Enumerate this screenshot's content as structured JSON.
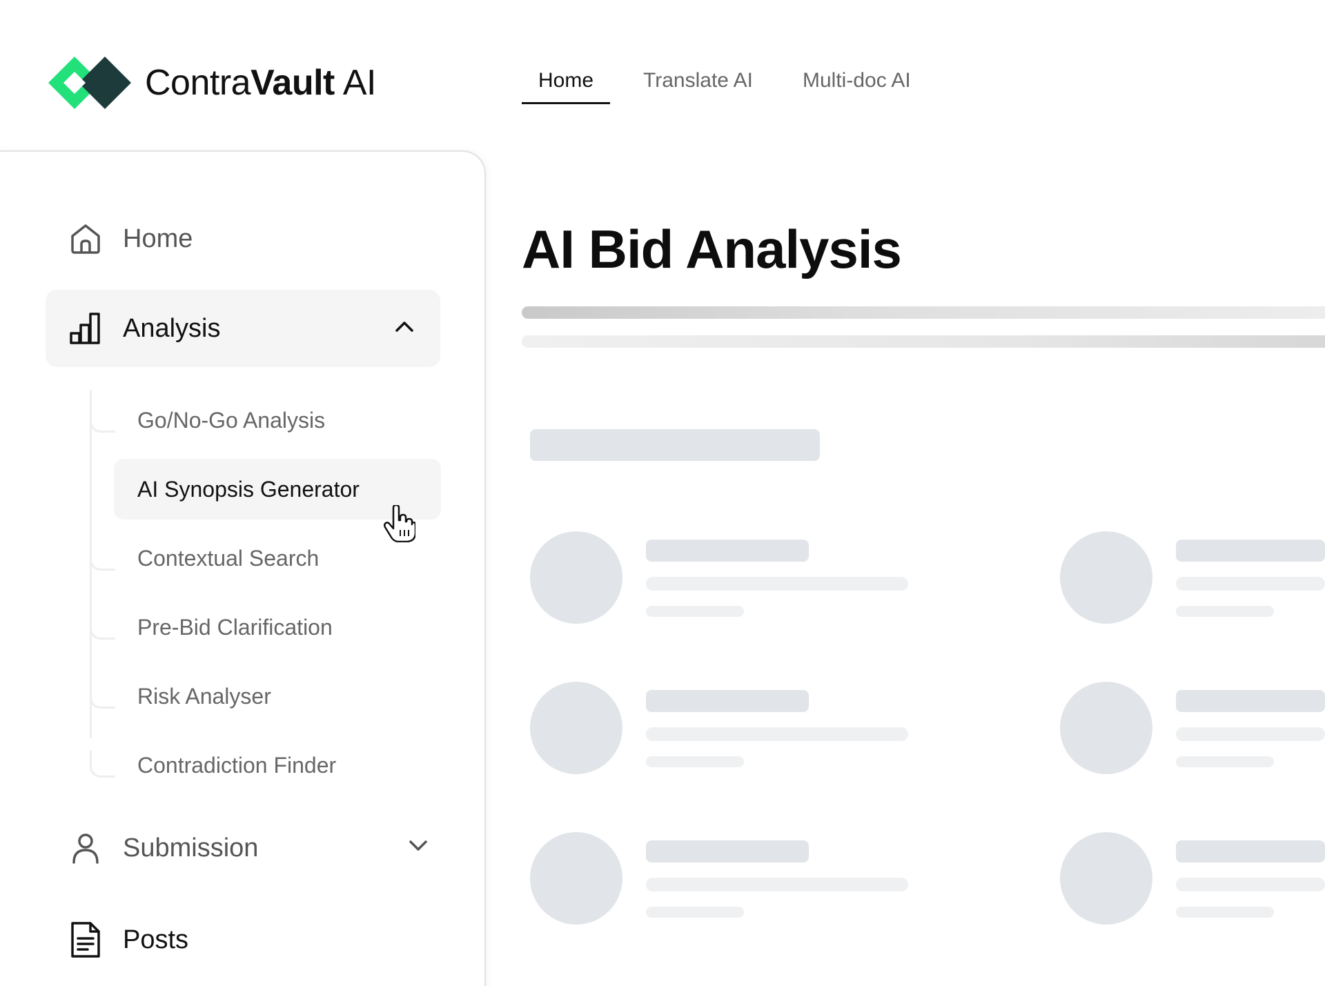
{
  "brand": {
    "name_part1": "Contra",
    "name_part2": "Vault",
    "name_part3": "AI",
    "colors": {
      "green": "#22e07a",
      "dark": "#1d3b3b"
    }
  },
  "top_nav": {
    "tabs": [
      {
        "label": "Home",
        "active": true
      },
      {
        "label": "Translate AI",
        "active": false
      },
      {
        "label": "Multi-doc AI",
        "active": false
      }
    ]
  },
  "sidebar": {
    "home": {
      "label": "Home",
      "icon": "home-icon"
    },
    "analysis": {
      "label": "Analysis",
      "icon": "bar-chart-icon",
      "expanded": true,
      "items": [
        {
          "label": "Go/No-Go Analysis",
          "active": false
        },
        {
          "label": "AI Synopsis Generator",
          "active": true
        },
        {
          "label": "Contextual Search",
          "active": false
        },
        {
          "label": "Pre-Bid Clarification",
          "active": false
        },
        {
          "label": "Risk Analyser",
          "active": false
        },
        {
          "label": "Contradiction Finder",
          "active": false
        }
      ]
    },
    "submission": {
      "label": "Submission",
      "icon": "user-icon",
      "expanded": false
    },
    "posts": {
      "label": "Posts",
      "icon": "document-icon"
    }
  },
  "main": {
    "title": "AI Bid Analysis"
  }
}
